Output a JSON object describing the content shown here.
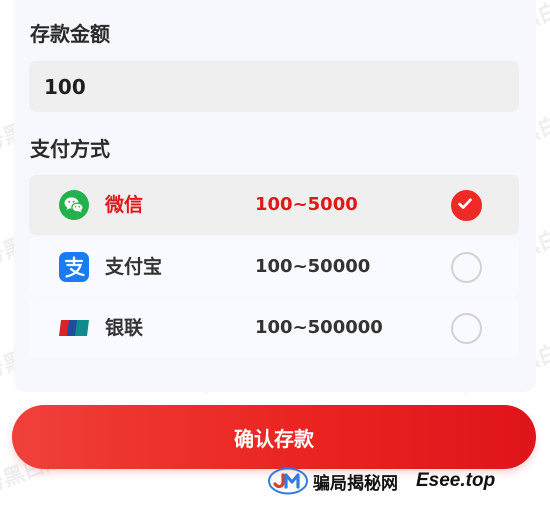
{
  "deposit": {
    "amount_label": "存款金额",
    "amount_value": "100",
    "method_label": "支付方式"
  },
  "methods": [
    {
      "name": "微信",
      "range": "100~5000",
      "icon": "wechat-icon",
      "selected": true
    },
    {
      "name": "支付宝",
      "range": "100~50000",
      "icon": "alipay-icon",
      "selected": false
    },
    {
      "name": "银联",
      "range": "100~500000",
      "icon": "unionpay-icon",
      "selected": false
    }
  ],
  "confirm_label": "确认存款",
  "watermark_text": "公众号黑白之猫",
  "footer": {
    "site_name": "骗局揭秘网",
    "domain": "Esee.top"
  },
  "colors": {
    "accent": "#e82420",
    "wechat": "#22b14c",
    "alipay": "#1a7cf0",
    "unionpay": "#d8232a"
  }
}
